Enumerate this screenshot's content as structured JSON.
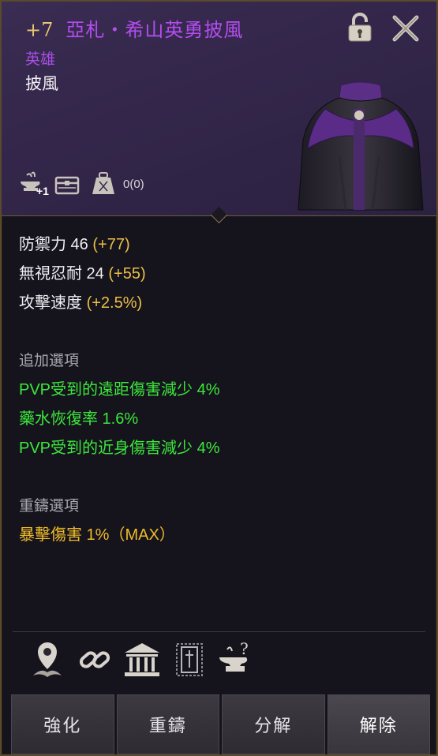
{
  "item": {
    "enhance": "+7",
    "name": "亞札・希山英勇披風",
    "grade": "英雄",
    "type": "披風",
    "tally": "0(0)",
    "anvil_badge": "+1"
  },
  "stats": {
    "defense_label": "防禦力 46",
    "defense_bonus": "(+77)",
    "ignore_label": "無視忍耐 24",
    "ignore_bonus": "(+55)",
    "speed_label": "攻擊速度",
    "speed_bonus": "(+2.5%)"
  },
  "extra_options": {
    "title": "追加選項",
    "items": [
      "PVP受到的遠距傷害減少 4%",
      "藥水恢復率 1.6%",
      "PVP受到的近身傷害減少 4%"
    ]
  },
  "recast_options": {
    "title": "重鑄選項",
    "items": [
      "暴擊傷害 1%（MAX）"
    ]
  },
  "buttons": [
    "強化",
    "重鑄",
    "分解",
    "解除"
  ],
  "colors": {
    "name": "#b44cf0",
    "enhance": "#e8c870",
    "bonus": "#ecc046",
    "extra_option": "#3ce83c",
    "recast_option": "#f0bc2a"
  },
  "icons": {
    "header": [
      "anvil-icon",
      "chest-icon",
      "weight-icon"
    ],
    "tools": [
      "location-pin-icon",
      "link-icon",
      "bank-icon",
      "engrave-icon",
      "anvil-question-icon"
    ],
    "top": [
      "lock-icon",
      "close-icon"
    ]
  }
}
